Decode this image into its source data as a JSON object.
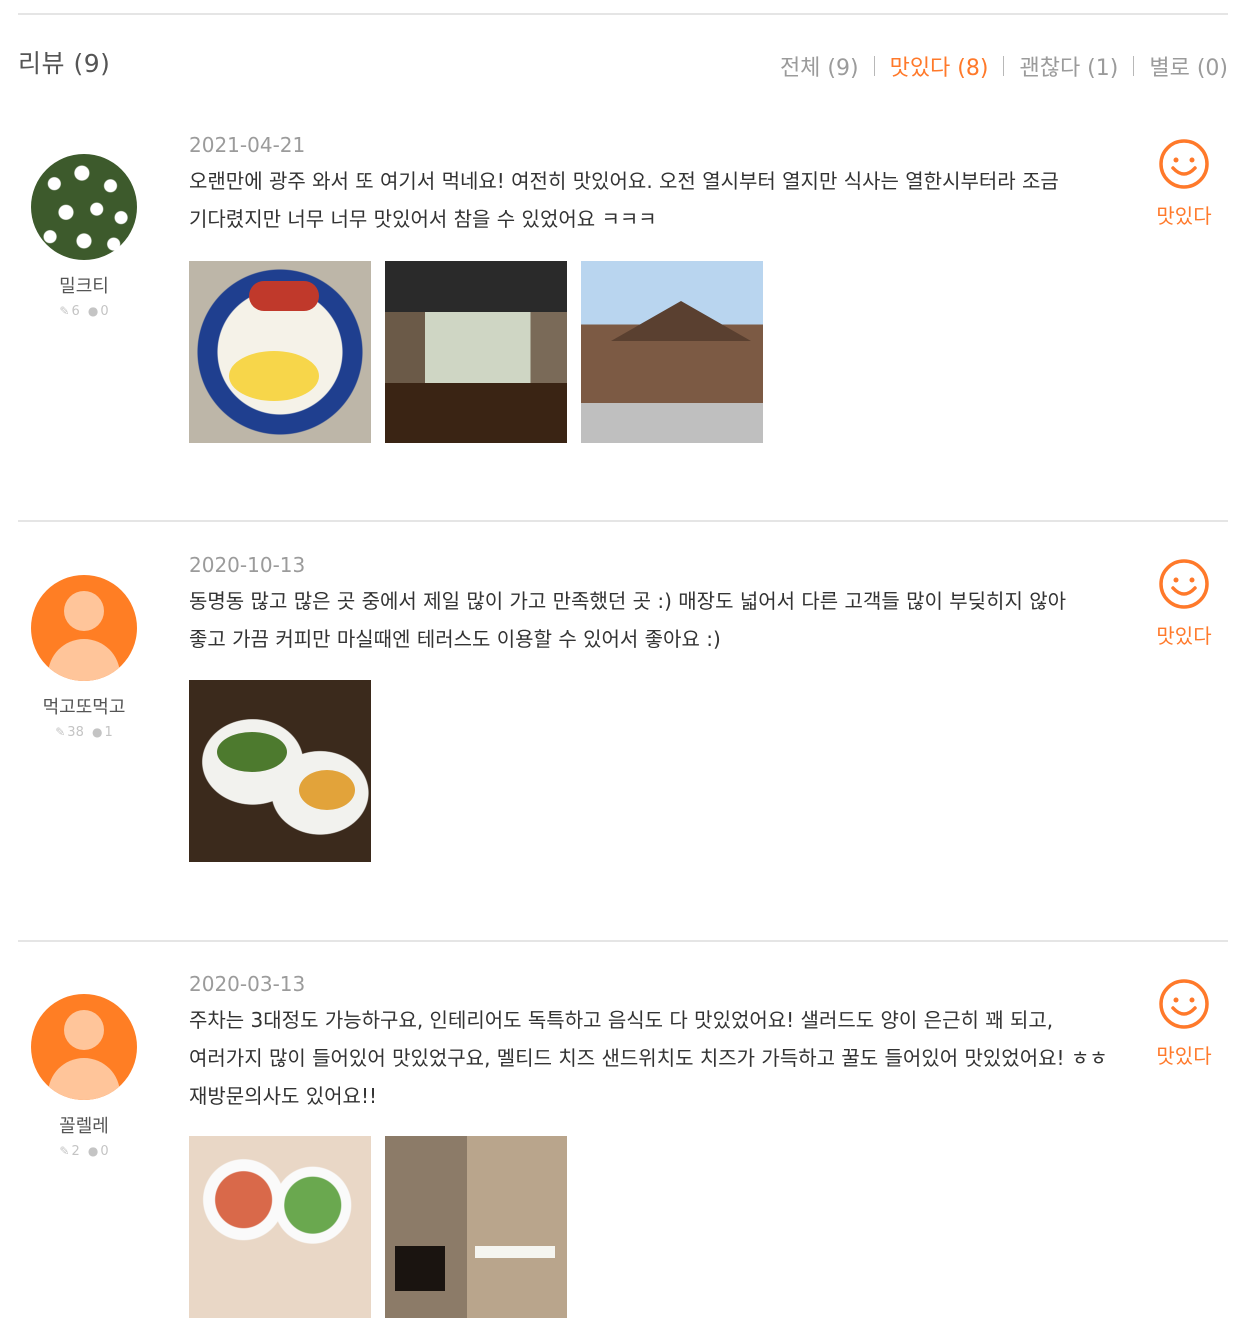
{
  "header": {
    "title": "리뷰 (9)",
    "filters": [
      {
        "label": "전체 (9)",
        "active": false
      },
      {
        "label": "맛있다 (8)",
        "active": true
      },
      {
        "label": "괜찮다 (1)",
        "active": false
      },
      {
        "label": "별로 (0)",
        "active": false
      }
    ]
  },
  "colors": {
    "accent": "#ff792a",
    "muted": "#9b9b9b",
    "divider": "#e5e5e5"
  },
  "reviews": [
    {
      "user": {
        "name": "밀크티",
        "reviews": "6",
        "followers": "0",
        "avatar": "flowers"
      },
      "date": "2021-04-21",
      "text": "오랜만에 광주 와서 또 여기서 먹네요! 여전히 맛있어요. 오전 열시부터 열지만 식사는 열한시부터라 조금 기다렸지만 너무 너무 맛있어서 참을 수 있었어요 ㅋㅋㅋ",
      "rating": {
        "label": "맛있다",
        "icon": "smile-icon"
      },
      "photos": [
        "food-plate-photo",
        "cafe-interior-photo",
        "building-exterior-photo"
      ]
    },
    {
      "user": {
        "name": "먹고또먹고",
        "reviews": "38",
        "followers": "1",
        "avatar": "default"
      },
      "date": "2020-10-13",
      "text": "동명동 많고 많은 곳 중에서 제일 많이 가고 만족했던 곳 :) 매장도 넓어서 다른 고객들 많이 부딪히지 않아 좋고 가끔 커피만 마실때엔 테러스도 이용할 수 있어서 좋아요 :)",
      "rating": {
        "label": "맛있다",
        "icon": "smile-icon"
      },
      "photos": [
        "salad-pasta-photo"
      ]
    },
    {
      "user": {
        "name": "꼴렐레",
        "reviews": "2",
        "followers": "0",
        "avatar": "default"
      },
      "date": "2020-03-13",
      "text": "주차는 3대정도 가능하구요, 인테리어도 독특하고 음식도 다 맛있었어요! 샐러드도 양이 은근히 꽤 되고, 여러가지 많이 들어있어 맛있었구요, 멜티드 치즈 샌드위치도 치즈가 가득하고 꿀도 들어있어 맛있었어요! ㅎㅎ 재방문의사도 있어요!!",
      "rating": {
        "label": "맛있다",
        "icon": "smile-icon"
      },
      "photos": [
        "table-dishes-photo",
        "stone-interior-photo"
      ]
    }
  ]
}
